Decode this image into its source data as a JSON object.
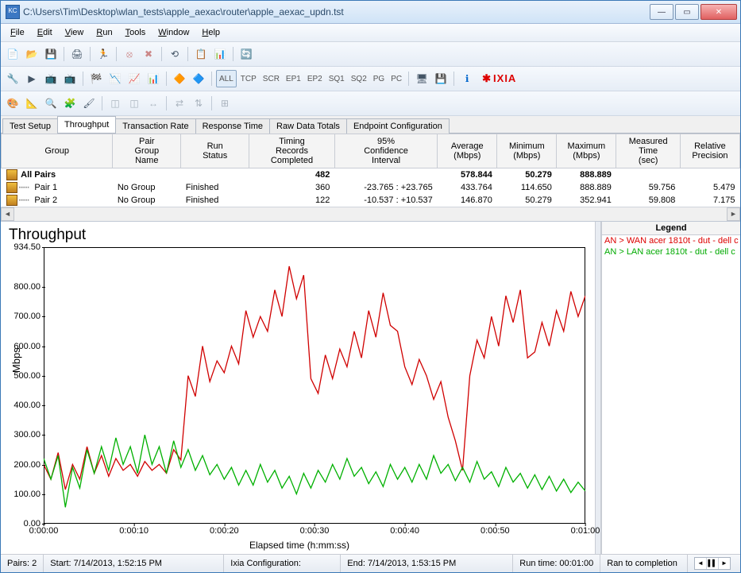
{
  "window": {
    "title": "C:\\Users\\Tim\\Desktop\\wlan_tests\\apple_aexac\\router\\apple_aexac_updn.tst",
    "app_icon_label": "KC"
  },
  "menu": [
    "File",
    "Edit",
    "View",
    "Run",
    "Tools",
    "Window",
    "Help"
  ],
  "toolbar2_txt": [
    "ALL",
    "TCP",
    "SCR",
    "EP1",
    "EP2",
    "SQ1",
    "SQ2",
    "PG",
    "PC"
  ],
  "brand": "IXIA",
  "tabs": [
    "Test Setup",
    "Throughput",
    "Transaction Rate",
    "Response Time",
    "Raw Data Totals",
    "Endpoint Configuration"
  ],
  "tabs_active": 1,
  "grid": {
    "headers": [
      "Group",
      "Pair Group Name",
      "Run Status",
      "Timing Records Completed",
      "95% Confidence Interval",
      "Average (Mbps)",
      "Minimum (Mbps)",
      "Maximum (Mbps)",
      "Measured Time (sec)",
      "Relative Precision"
    ],
    "rows": [
      {
        "icon": true,
        "label": "All Pairs",
        "bold": true,
        "pg": "",
        "rs": "",
        "trc": "482",
        "ci": "",
        "avg": "578.844",
        "min": "50.279",
        "max": "888.889",
        "mt": "",
        "rp": ""
      },
      {
        "icon": true,
        "tree": true,
        "label": "Pair 1",
        "pg": "No Group",
        "rs": "Finished",
        "trc": "360",
        "ci": "-23.765 : +23.765",
        "avg": "433.764",
        "min": "114.650",
        "max": "888.889",
        "mt": "59.756",
        "rp": "5.479"
      },
      {
        "icon": true,
        "tree": true,
        "label": "Pair 2",
        "pg": "No Group",
        "rs": "Finished",
        "trc": "122",
        "ci": "-10.537 : +10.537",
        "avg": "146.870",
        "min": "50.279",
        "max": "352.941",
        "mt": "59.808",
        "rp": "7.175"
      }
    ]
  },
  "chart_data": {
    "type": "line",
    "title": "Throughput",
    "ylabel": "Mbps",
    "xlabel": "Elapsed time (h:mm:ss)",
    "ylim": [
      0,
      934.5
    ],
    "yticks": [
      0,
      100,
      200,
      300,
      400,
      500,
      600,
      700,
      800,
      934.5
    ],
    "ytick_labels": [
      "0.00",
      "100.00",
      "200.00",
      "300.00",
      "400.00",
      "500.00",
      "600.00",
      "700.00",
      "800.00",
      "934.50"
    ],
    "xlim": [
      0,
      60
    ],
    "xticks": [
      0,
      10,
      20,
      30,
      40,
      50,
      60
    ],
    "xtick_labels": [
      "0:00:00",
      "0:00:10",
      "0:00:20",
      "0:00:30",
      "0:00:40",
      "0:00:50",
      "0:01:00"
    ],
    "series": [
      {
        "name": "AN > WAN acer 1810t - dut - dell c",
        "color": "#d00000",
        "y": [
          200,
          150,
          240,
          115,
          200,
          150,
          260,
          170,
          230,
          160,
          220,
          180,
          200,
          160,
          210,
          180,
          200,
          170,
          250,
          215,
          500,
          430,
          600,
          480,
          550,
          510,
          600,
          540,
          720,
          630,
          700,
          650,
          790,
          700,
          870,
          760,
          840,
          490,
          440,
          570,
          490,
          590,
          530,
          650,
          560,
          720,
          630,
          780,
          670,
          650,
          530,
          470,
          555,
          500,
          420,
          480,
          360,
          280,
          180,
          500,
          620,
          560,
          700,
          600,
          770,
          680,
          790,
          560,
          580,
          680,
          600,
          720,
          650,
          785,
          700,
          770
        ]
      },
      {
        "name": "AN > LAN acer 1810t - dut - dell c",
        "color": "#00b000",
        "y": [
          220,
          150,
          230,
          55,
          190,
          120,
          250,
          170,
          260,
          180,
          290,
          200,
          260,
          170,
          300,
          200,
          260,
          170,
          280,
          190,
          250,
          180,
          230,
          165,
          200,
          150,
          190,
          130,
          180,
          130,
          200,
          140,
          180,
          120,
          160,
          100,
          170,
          120,
          180,
          140,
          200,
          150,
          220,
          160,
          190,
          135,
          175,
          125,
          200,
          150,
          190,
          140,
          200,
          150,
          230,
          170,
          200,
          145,
          190,
          140,
          210,
          150,
          175,
          125,
          190,
          140,
          170,
          120,
          165,
          115,
          160,
          110,
          150,
          105,
          140,
          110
        ]
      }
    ],
    "x_step": 0.8
  },
  "legend": {
    "title": "Legend"
  },
  "status": {
    "pairs": "Pairs: 2",
    "start": "Start: 7/14/2013, 1:52:15 PM",
    "ixia": "Ixia Configuration:",
    "end": "End: 7/14/2013, 1:53:15 PM",
    "run": "Run time: 00:01:00",
    "ran": "Ran to completion"
  }
}
